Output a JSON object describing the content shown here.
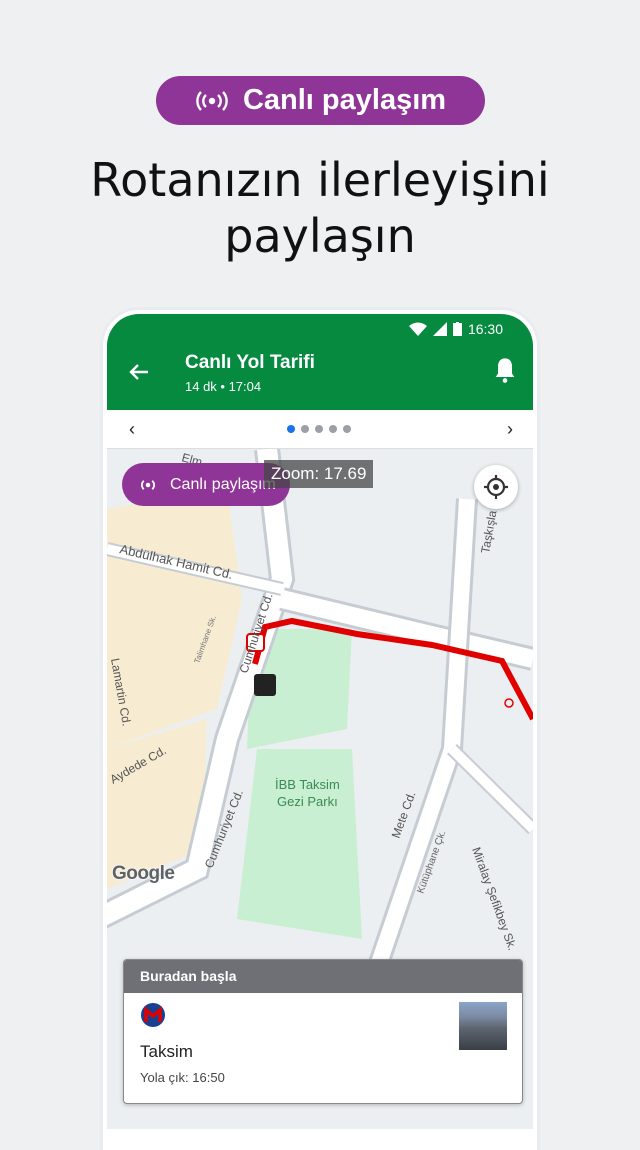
{
  "hero": {
    "pill_label": "Canlı paylaşım",
    "title_line1": "Rotanızın ilerleyişini",
    "title_line2": "paylaşın"
  },
  "status_bar": {
    "time": "16:30"
  },
  "app_bar": {
    "title": "Canlı Yol Tarifi",
    "subtitle": "14 dk • 17:04"
  },
  "pager": {
    "prev": "‹",
    "next": "›",
    "pages": 5,
    "active_page": 1
  },
  "map": {
    "share_pill_label": "Canlı paylaşım",
    "zoom_label": "Zoom: 17.69",
    "attribution": "Google",
    "street_labels": [
      "Elm",
      "Abdülhak Hamit Cd.",
      "Cumhuriyet Cd.",
      "Talimhane Sk.",
      "Lamartin Cd.",
      "Aydede Cd.",
      "Cumhuriyet Cd.",
      "İBB Taksim",
      "Gezi Parkı",
      "Mete Cd.",
      "Kütüphane Çk.",
      "Miralay Şefikbey Sk.",
      "Taşkışla"
    ],
    "route_color": "#e00000",
    "park_color": "#c8efd2"
  },
  "sheet": {
    "header": "Buradan başla",
    "place": "Taksim",
    "depart": "Yola çık: 16:50"
  },
  "colors": {
    "brand_purple": "#8e3597",
    "app_green": "#058a3f"
  }
}
